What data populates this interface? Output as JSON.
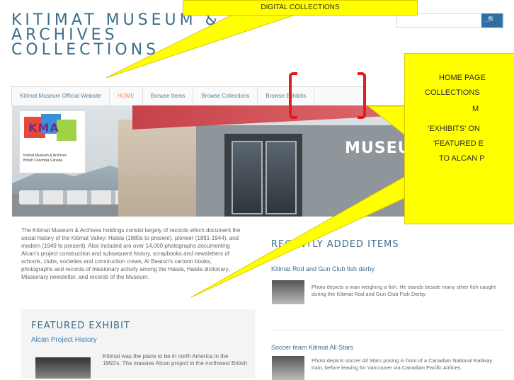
{
  "header": {
    "title_lines": [
      "KITIMAT MUSEUM &",
      "ARCHIVES",
      "COLLECTIONS"
    ]
  },
  "nav": {
    "items": [
      {
        "label": "Kitimat Museum Official Website"
      },
      {
        "label": "HOME"
      },
      {
        "label": "Browse Items"
      },
      {
        "label": "Browse Collections"
      },
      {
        "label": "Browse Exhibits"
      }
    ]
  },
  "hero": {
    "logo_letters": "KMA",
    "logo_caption_1": "Kitimat Museum & Archives",
    "logo_caption_2": "British Columbia Canada",
    "sign": "MUSEUM"
  },
  "intro": {
    "text": "The Kitimat Museum & Archives holdings consist largely of records which document the social history of the Kitimat Valley: Haisla (1880s to present), pioneer (1891-1944), and modern (1949 to present). Also included are over 14,000 photographs documenting Alcan's project construction and subsequent history, scrapbooks and newsletters of schools, clubs, societies and construction crews, Al Beaton's cartoon books, photographs and records of missionary activity among the Haisla, Haisla dictionary, Missionary newsletter, and records of the Museum."
  },
  "featured": {
    "heading": "FEATURED EXHIBIT",
    "link": "Alcan Project History",
    "text": "Kitimat was the place to be in north America in the 1950's. The massive Alcan project in the northwest British"
  },
  "recent": {
    "heading": "RECENTLY ADDED ITEMS",
    "items": [
      {
        "title": "Kitimat Rod and Gun Club fish derby",
        "text": "Photo depicts a man weighing a fish. He stands beside many other fish caught during the Kitimat Rod and Gun Club Fish Derby."
      },
      {
        "title": "Soccer team Kitimat All Stars",
        "text": "Photo depicts soccer All Stars posing in front of a Canadian National Railway train, before leaving for Vancouver via Canadian Pacific Airlines."
      }
    ]
  },
  "annotations": {
    "top": "DIGITAL COLLECTIONS",
    "right_1": "HOME PAGE",
    "right_2": "COLLECTIONS",
    "right_3": "M",
    "right_4": "'EXHIBITS' ON",
    "right_5": "'FEATURED E",
    "right_6": "TO ALCAN P"
  },
  "colors": {
    "title": "#3c6f8a",
    "nav_active": "#f08a50",
    "link": "#3c7fb0",
    "callout": "#ffff00",
    "bracket": "#e01e1e"
  }
}
